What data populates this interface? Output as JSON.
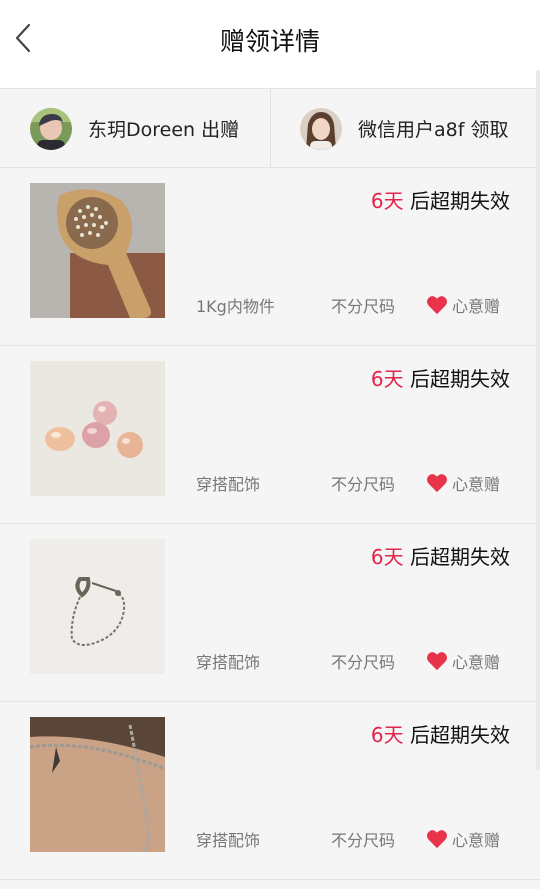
{
  "header": {
    "title": "赠领详情",
    "back_icon": "chevron-left-icon"
  },
  "users": {
    "giver": {
      "name": "东玥Doreen 出赠"
    },
    "receiver": {
      "name": "微信用户a8f 领取"
    }
  },
  "items": [
    {
      "image": "wooden-hairbrush",
      "expire_days": "6天",
      "expire_text": " 后超期失效",
      "category": "1Kg内物件",
      "size": "不分尺码",
      "type": "心意赠"
    },
    {
      "image": "pink-pearls",
      "expire_days": "6天",
      "expire_text": " 后超期失效",
      "category": "穿搭配饰",
      "size": "不分尺码",
      "type": "心意赠"
    },
    {
      "image": "ear-cuff-chain",
      "expire_days": "6天",
      "expire_text": " 后超期失效",
      "category": "穿搭配饰",
      "size": "不分尺码",
      "type": "心意赠"
    },
    {
      "image": "silver-bracelet",
      "expire_days": "6天",
      "expire_text": " 后超期失效",
      "category": "穿搭配饰",
      "size": "不分尺码",
      "type": "心意赠"
    }
  ],
  "colors": {
    "accent": "#e2244a",
    "heart": "#e8334a",
    "background": "#f5f5f5",
    "header_bg": "#ffffff"
  }
}
